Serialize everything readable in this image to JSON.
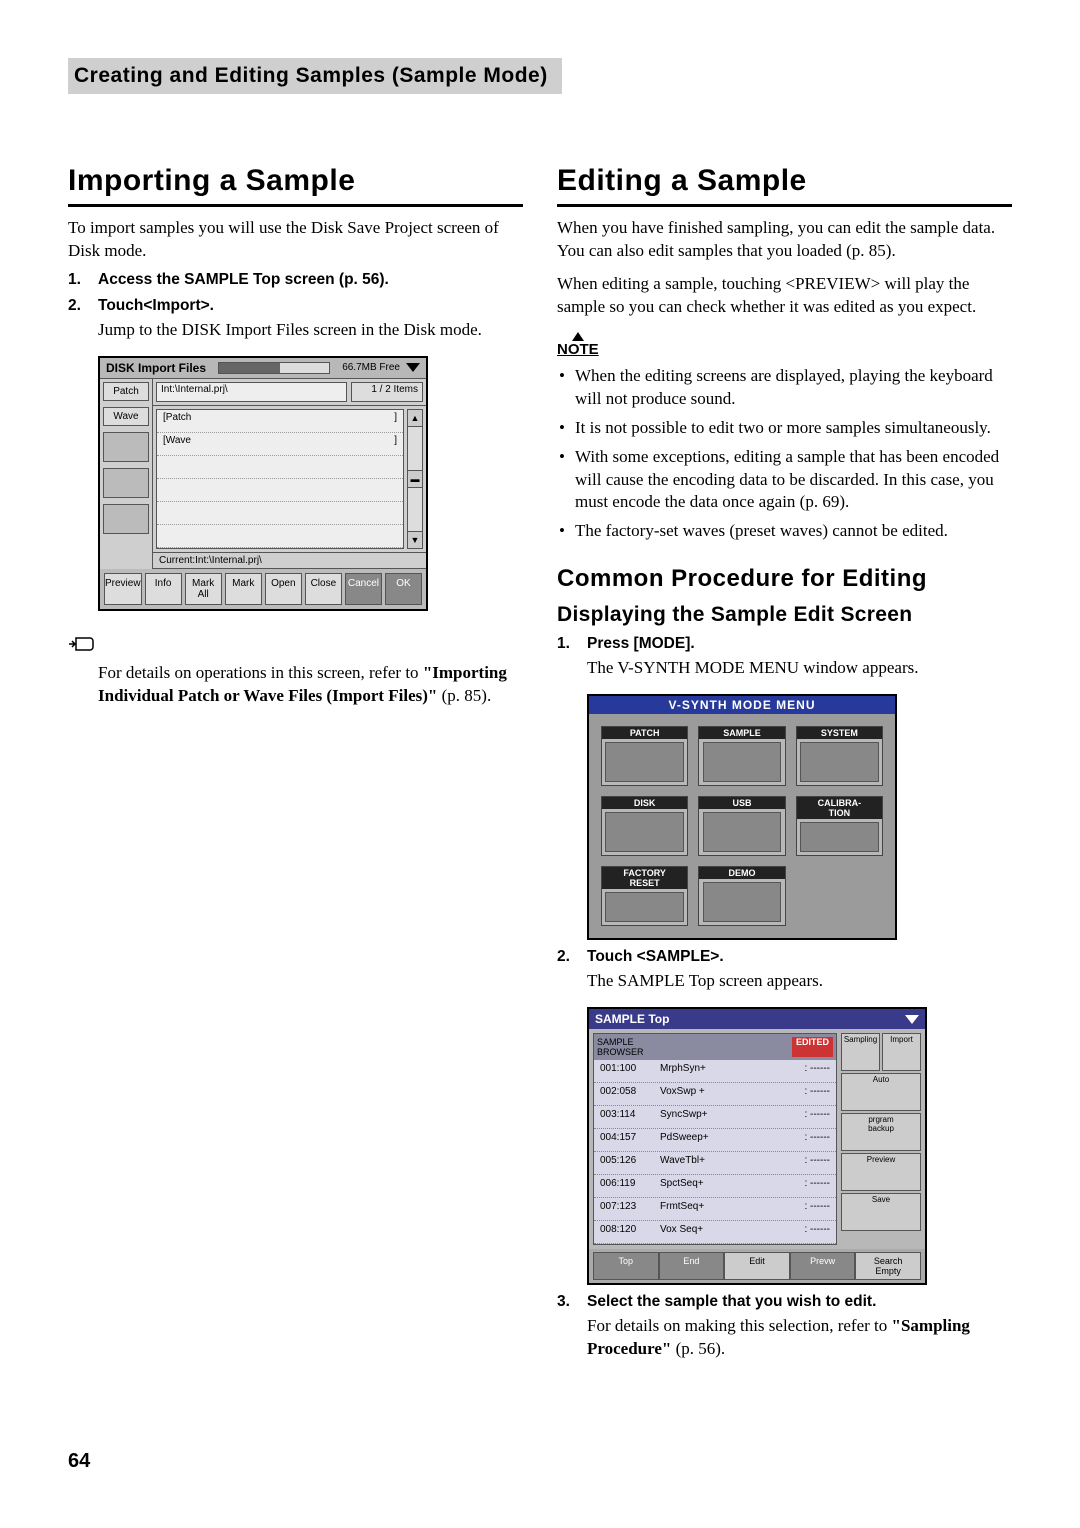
{
  "header": "Creating and Editing Samples (Sample Mode)",
  "page_number": "64",
  "left": {
    "title": "Importing a Sample",
    "intro": "To import samples you will use the Disk Save Project screen of Disk mode.",
    "steps": [
      {
        "title": "Access the SAMPLE Top screen (p. 56)."
      },
      {
        "title": "Touch<Import>.",
        "body": "Jump to the DISK Import Files screen in the Disk mode."
      }
    ],
    "tip_pre": "For details on operations in this screen, refer to ",
    "tip_bold": "\"Importing Individual Patch or Wave Files (Import Files)\"",
    "tip_post": " (p. 85).",
    "disk_screenshot": {
      "title": "DISK Import Files",
      "free": "66.7MB Free",
      "tabs": [
        "Patch",
        "Wave"
      ],
      "path": "Int:\\Internal.prj\\",
      "count": "1 / 2 Items",
      "rows": [
        {
          "name": "[Patch",
          "right": "]"
        },
        {
          "name": "[Wave",
          "right": "]"
        }
      ],
      "current": "Current:Int:\\Internal.prj\\",
      "buttons": [
        "Preview",
        "Info",
        "Mark All",
        "Mark",
        "Open",
        "Close",
        "Cancel",
        "OK"
      ]
    }
  },
  "right": {
    "title": "Editing a Sample",
    "p1": "When you have finished sampling, you can edit the sample data. You can also edit samples that you loaded (p. 85).",
    "p2": "When editing a sample, touching <PREVIEW> will play the sample so you can check whether it was edited as you expect.",
    "note_label": "NOTE",
    "notes": [
      "When the editing screens are displayed, playing the keyboard will not produce sound.",
      "It is not possible to edit two or more samples simultaneously.",
      "With some exceptions, editing a sample that has been encoded will cause the encoding data to be discarded. In this case, you must encode the data once again (p. 69).",
      "The factory-set waves (preset waves) cannot be edited."
    ],
    "sub_title": "Common Procedure for Editing",
    "sub_sub": "Displaying the Sample Edit Screen",
    "steps": [
      {
        "title": "Press [MODE].",
        "body": "The V-SYNTH MODE MENU window appears."
      },
      {
        "title": "Touch <SAMPLE>.",
        "body": "The SAMPLE Top screen appears."
      },
      {
        "title": "Select the sample that you wish to edit.",
        "body_pre": "For details on making this selection, refer to ",
        "body_bold": "\"Sampling Procedure\"",
        "body_post": " (p. 56)."
      }
    ],
    "mode_menu": {
      "title": "V-SYNTH MODE MENU",
      "cells": [
        "PATCH",
        "SAMPLE",
        "SYSTEM",
        "DISK",
        "USB",
        "CALIBRA-\nTION",
        "FACTORY\nRESET",
        "DEMO",
        ""
      ]
    },
    "sample_top": {
      "header": "SAMPLE Top",
      "browser_label": "SAMPLE\nBROWSER",
      "edited": "EDITED",
      "right_labels": [
        "Sampling",
        "Import",
        "Auto",
        "prgram\nbackup",
        "Preview",
        "",
        "Save"
      ],
      "rows": [
        {
          "id": "001:100",
          "name": "MrphSyn+",
          "tail": ": ------"
        },
        {
          "id": "002:058",
          "name": "VoxSwp +",
          "tail": ": ------"
        },
        {
          "id": "003:114",
          "name": "SyncSwp+",
          "tail": ": ------"
        },
        {
          "id": "004:157",
          "name": "PdSweep+",
          "tail": ": ------"
        },
        {
          "id": "005:126",
          "name": "WaveTbl+",
          "tail": ": ------"
        },
        {
          "id": "006:119",
          "name": "SpctSeq+",
          "tail": ": ------"
        },
        {
          "id": "007:123",
          "name": "FrmtSeq+",
          "tail": ": ------"
        },
        {
          "id": "008:120",
          "name": "Vox Seq+",
          "tail": ": ------"
        }
      ],
      "bottom": [
        "Top",
        "End",
        "Edit",
        "Prevw",
        "Search\nEmpty"
      ]
    }
  }
}
